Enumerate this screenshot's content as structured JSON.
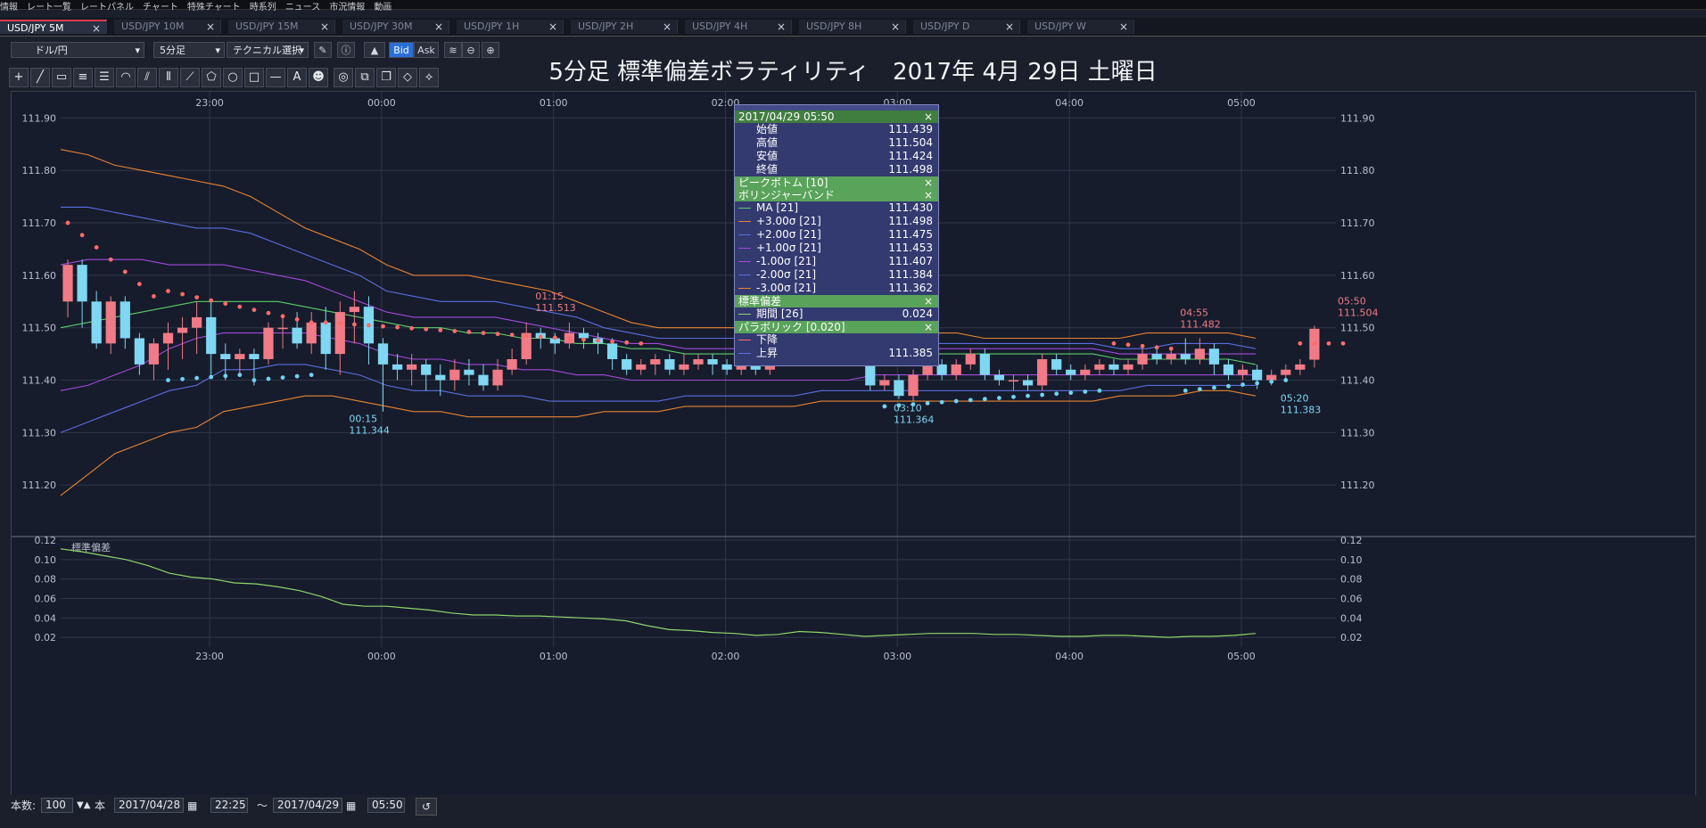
{
  "menubar": [
    "情報",
    "レート一覧",
    "レートパネル",
    "チャート",
    "特殊チャート",
    "時系列",
    "ニュース",
    "市況情報",
    "動画"
  ],
  "tabs": [
    {
      "label": "USD/JPY 5M",
      "active": true
    },
    {
      "label": "USD/JPY 10M"
    },
    {
      "label": "USD/JPY 15M"
    },
    {
      "label": "USD/JPY 30M"
    },
    {
      "label": "USD/JPY 1H"
    },
    {
      "label": "USD/JPY 2H"
    },
    {
      "label": "USD/JPY 4H"
    },
    {
      "label": "USD/JPY 8H"
    },
    {
      "label": "USD/JPY D"
    },
    {
      "label": "USD/JPY W"
    }
  ],
  "toolbar": {
    "pair": "ドル/円",
    "timeframe": "5分足",
    "technical": "テクニカル選択",
    "bid": "Bid",
    "ask": "Ask"
  },
  "title": "5分足 標準偏差ボラティリティ　2017年 4月 29日 土曜日",
  "chart_data": {
    "type": "candlestick",
    "y_axis": {
      "min": 111.1,
      "max": 111.95,
      "ticks": [
        "111.90",
        "111.80",
        "111.70",
        "111.60",
        "111.50",
        "111.40",
        "111.30",
        "111.20"
      ]
    },
    "time_labels": [
      "23:00",
      "00:00",
      "01:00",
      "02:00",
      "03:00",
      "04:00",
      "05:00"
    ],
    "annotations": [
      {
        "time": "00:15",
        "price": "111.344"
      },
      {
        "time": "01:15",
        "price": "111.513"
      },
      {
        "time": "03:10",
        "price": "111.364"
      },
      {
        "time": "04:55",
        "price": "111.482"
      },
      {
        "time": "05:20",
        "price": "111.383"
      },
      {
        "time": "05:50",
        "price": "111.504"
      }
    ],
    "candles": [
      [
        111.55,
        111.62,
        111.63,
        111.52
      ],
      [
        111.62,
        111.55,
        111.63,
        111.5
      ],
      [
        111.55,
        111.47,
        111.57,
        111.46
      ],
      [
        111.47,
        111.55,
        111.56,
        111.45
      ],
      [
        111.55,
        111.48,
        111.56,
        111.46
      ],
      [
        111.48,
        111.43,
        111.49,
        111.41
      ],
      [
        111.43,
        111.47,
        111.48,
        111.4
      ],
      [
        111.47,
        111.49,
        111.51,
        111.42
      ],
      [
        111.49,
        111.5,
        111.52,
        111.44
      ],
      [
        111.5,
        111.52,
        111.55,
        111.45
      ],
      [
        111.52,
        111.45,
        111.55,
        111.41
      ],
      [
        111.45,
        111.44,
        111.47,
        111.4
      ],
      [
        111.44,
        111.45,
        111.46,
        111.41
      ],
      [
        111.45,
        111.44,
        111.46,
        111.39
      ],
      [
        111.44,
        111.5,
        111.51,
        111.43
      ],
      [
        111.5,
        111.5,
        111.52,
        111.46
      ],
      [
        111.5,
        111.47,
        111.53,
        111.46
      ],
      [
        111.47,
        111.51,
        111.53,
        111.45
      ],
      [
        111.51,
        111.45,
        111.54,
        111.42
      ],
      [
        111.45,
        111.53,
        111.55,
        111.41
      ],
      [
        111.53,
        111.54,
        111.57,
        111.47
      ],
      [
        111.54,
        111.47,
        111.56,
        111.43
      ],
      [
        111.47,
        111.43,
        111.48,
        111.34
      ],
      [
        111.43,
        111.42,
        111.45,
        111.4
      ],
      [
        111.42,
        111.43,
        111.45,
        111.39
      ],
      [
        111.43,
        111.41,
        111.44,
        111.38
      ],
      [
        111.41,
        111.4,
        111.43,
        111.37
      ],
      [
        111.4,
        111.42,
        111.44,
        111.38
      ],
      [
        111.42,
        111.41,
        111.44,
        111.39
      ],
      [
        111.41,
        111.39,
        111.43,
        111.38
      ],
      [
        111.39,
        111.42,
        111.44,
        111.38
      ],
      [
        111.42,
        111.44,
        111.46,
        111.41
      ],
      [
        111.44,
        111.49,
        111.51,
        111.43
      ],
      [
        111.49,
        111.48,
        111.5,
        111.46
      ],
      [
        111.48,
        111.47,
        111.49,
        111.45
      ],
      [
        111.47,
        111.49,
        111.51,
        111.46
      ],
      [
        111.49,
        111.48,
        111.5,
        111.46
      ],
      [
        111.48,
        111.47,
        111.49,
        111.45
      ],
      [
        111.47,
        111.44,
        111.48,
        111.42
      ],
      [
        111.44,
        111.42,
        111.45,
        111.41
      ],
      [
        111.42,
        111.43,
        111.44,
        111.41
      ],
      [
        111.43,
        111.44,
        111.45,
        111.41
      ],
      [
        111.44,
        111.42,
        111.45,
        111.41
      ],
      [
        111.42,
        111.43,
        111.45,
        111.41
      ],
      [
        111.43,
        111.44,
        111.45,
        111.42
      ],
      [
        111.44,
        111.43,
        111.45,
        111.41
      ],
      [
        111.43,
        111.42,
        111.44,
        111.41
      ],
      [
        111.42,
        111.43,
        111.44,
        111.41
      ],
      [
        111.43,
        111.42,
        111.44,
        111.41
      ],
      [
        111.42,
        111.45,
        111.46,
        111.41
      ],
      [
        111.45,
        111.46,
        111.47,
        111.43
      ],
      [
        111.46,
        111.45,
        111.47,
        111.44
      ],
      [
        111.45,
        111.44,
        111.46,
        111.43
      ],
      [
        111.44,
        111.45,
        111.46,
        111.43
      ],
      [
        111.45,
        111.44,
        111.46,
        111.43
      ],
      [
        111.44,
        111.45,
        111.47,
        111.43
      ],
      [
        111.45,
        111.39,
        111.46,
        111.38
      ],
      [
        111.39,
        111.4,
        111.41,
        111.38
      ],
      [
        111.4,
        111.37,
        111.41,
        111.364
      ],
      [
        111.37,
        111.41,
        111.42,
        111.36
      ],
      [
        111.41,
        111.43,
        111.44,
        111.4
      ],
      [
        111.43,
        111.41,
        111.44,
        111.4
      ],
      [
        111.41,
        111.43,
        111.44,
        111.4
      ],
      [
        111.43,
        111.45,
        111.46,
        111.42
      ],
      [
        111.45,
        111.41,
        111.46,
        111.4
      ],
      [
        111.41,
        111.4,
        111.42,
        111.39
      ],
      [
        111.4,
        111.4,
        111.41,
        111.38
      ],
      [
        111.4,
        111.39,
        111.41,
        111.38
      ],
      [
        111.39,
        111.44,
        111.45,
        111.38
      ],
      [
        111.44,
        111.42,
        111.45,
        111.41
      ],
      [
        111.42,
        111.41,
        111.43,
        111.4
      ],
      [
        111.41,
        111.42,
        111.43,
        111.4
      ],
      [
        111.42,
        111.43,
        111.44,
        111.41
      ],
      [
        111.43,
        111.42,
        111.44,
        111.41
      ],
      [
        111.42,
        111.43,
        111.44,
        111.41
      ],
      [
        111.43,
        111.45,
        111.46,
        111.42
      ],
      [
        111.45,
        111.44,
        111.46,
        111.43
      ],
      [
        111.44,
        111.45,
        111.46,
        111.43
      ],
      [
        111.45,
        111.44,
        111.48,
        111.43
      ],
      [
        111.44,
        111.46,
        111.48,
        111.43
      ],
      [
        111.46,
        111.43,
        111.47,
        111.41
      ],
      [
        111.43,
        111.41,
        111.44,
        111.4
      ],
      [
        111.41,
        111.42,
        111.43,
        111.4
      ],
      [
        111.42,
        111.4,
        111.43,
        111.383
      ],
      [
        111.4,
        111.41,
        111.42,
        111.39
      ],
      [
        111.41,
        111.42,
        111.43,
        111.4
      ],
      [
        111.42,
        111.43,
        111.44,
        111.41
      ],
      [
        111.439,
        111.498,
        111.504,
        111.424
      ]
    ],
    "series": [
      {
        "name": "MA [21]",
        "color": "#5ecb6a",
        "values": [
          111.5,
          111.51,
          111.52,
          111.53,
          111.54,
          111.55,
          111.55,
          111.55,
          111.55,
          111.54,
          111.53,
          111.52,
          111.51,
          111.5,
          111.5,
          111.49,
          111.49,
          111.48,
          111.48,
          111.47,
          111.47,
          111.46,
          111.46,
          111.45,
          111.45,
          111.45,
          111.45,
          111.45,
          111.45,
          111.45,
          111.45,
          111.45,
          111.45,
          111.45,
          111.45,
          111.45,
          111.45,
          111.45,
          111.45,
          111.44,
          111.44,
          111.44,
          111.44,
          111.44,
          111.43
        ]
      },
      {
        "name": "+3.00σ [21]",
        "color": "#e78431",
        "values": [
          111.84,
          111.83,
          111.81,
          111.8,
          111.79,
          111.78,
          111.77,
          111.75,
          111.72,
          111.69,
          111.67,
          111.65,
          111.62,
          111.6,
          111.6,
          111.6,
          111.59,
          111.58,
          111.57,
          111.55,
          111.53,
          111.51,
          111.5,
          111.5,
          111.5,
          111.5,
          111.49,
          111.49,
          111.5,
          111.5,
          111.49,
          111.49,
          111.49,
          111.49,
          111.48,
          111.48,
          111.48,
          111.48,
          111.48,
          111.48,
          111.49,
          111.49,
          111.49,
          111.49,
          111.48
        ]
      },
      {
        "name": "+2.00σ [21]",
        "color": "#5a6ee0",
        "values": [
          111.73,
          111.73,
          111.72,
          111.71,
          111.7,
          111.69,
          111.69,
          111.68,
          111.66,
          111.64,
          111.62,
          111.6,
          111.57,
          111.56,
          111.55,
          111.55,
          111.55,
          111.54,
          111.53,
          111.52,
          111.5,
          111.49,
          111.48,
          111.48,
          111.48,
          111.48,
          111.48,
          111.48,
          111.48,
          111.48,
          111.47,
          111.47,
          111.47,
          111.47,
          111.47,
          111.47,
          111.47,
          111.47,
          111.47,
          111.46,
          111.46,
          111.47,
          111.47,
          111.47,
          111.46
        ]
      },
      {
        "name": "+1.00σ [21]",
        "color": "#a24adb",
        "values": [
          111.62,
          111.63,
          111.63,
          111.63,
          111.62,
          111.62,
          111.62,
          111.61,
          111.6,
          111.59,
          111.57,
          111.55,
          111.53,
          111.52,
          111.52,
          111.52,
          111.52,
          111.51,
          111.5,
          111.49,
          111.48,
          111.47,
          111.47,
          111.46,
          111.46,
          111.46,
          111.46,
          111.46,
          111.46,
          111.46,
          111.46,
          111.46,
          111.46,
          111.46,
          111.46,
          111.46,
          111.46,
          111.46,
          111.46,
          111.45,
          111.45,
          111.45,
          111.45,
          111.45,
          111.45
        ]
      },
      {
        "name": "-1.00σ [21]",
        "color": "#a24adb",
        "values": [
          111.38,
          111.39,
          111.41,
          111.43,
          111.46,
          111.48,
          111.49,
          111.49,
          111.49,
          111.49,
          111.48,
          111.47,
          111.45,
          111.44,
          111.44,
          111.43,
          111.43,
          111.42,
          111.42,
          111.41,
          111.41,
          111.4,
          111.4,
          111.4,
          111.4,
          111.4,
          111.4,
          111.4,
          111.4,
          111.4,
          111.41,
          111.41,
          111.41,
          111.41,
          111.41,
          111.41,
          111.41,
          111.41,
          111.41,
          111.41,
          111.41,
          111.41,
          111.41,
          111.41,
          111.41
        ]
      },
      {
        "name": "-2.00σ [21]",
        "color": "#5a6ee0",
        "values": [
          111.3,
          111.32,
          111.34,
          111.36,
          111.38,
          111.39,
          111.42,
          111.42,
          111.43,
          111.43,
          111.42,
          111.41,
          111.39,
          111.38,
          111.38,
          111.37,
          111.37,
          111.37,
          111.36,
          111.36,
          111.36,
          111.36,
          111.36,
          111.37,
          111.37,
          111.37,
          111.37,
          111.37,
          111.38,
          111.38,
          111.38,
          111.38,
          111.38,
          111.38,
          111.38,
          111.38,
          111.38,
          111.38,
          111.38,
          111.38,
          111.39,
          111.39,
          111.39,
          111.39,
          111.39
        ]
      },
      {
        "name": "-3.00σ [21]",
        "color": "#e78431",
        "values": [
          111.18,
          111.22,
          111.26,
          111.28,
          111.3,
          111.31,
          111.34,
          111.35,
          111.36,
          111.37,
          111.37,
          111.36,
          111.35,
          111.34,
          111.34,
          111.33,
          111.33,
          111.33,
          111.33,
          111.33,
          111.34,
          111.34,
          111.34,
          111.35,
          111.35,
          111.35,
          111.35,
          111.35,
          111.36,
          111.36,
          111.36,
          111.36,
          111.36,
          111.36,
          111.36,
          111.36,
          111.36,
          111.36,
          111.36,
          111.37,
          111.37,
          111.37,
          111.38,
          111.38,
          111.37
        ]
      }
    ],
    "sar_down": {
      "color": "#ff6b6b",
      "from": 0,
      "to": 17,
      "start": 111.7,
      "end": 111.51
    },
    "sar_down2": {
      "color": "#ff6b6b",
      "from": 18,
      "to": 45,
      "start": 111.51,
      "end": 111.47
    },
    "sar_up": {
      "color": "#6fd3f0"
    },
    "subchart": {
      "label": "標準偏差",
      "ticks": [
        "0.12",
        "0.10",
        "0.08",
        "0.06",
        "0.04",
        "0.02"
      ],
      "min": 0.01,
      "max": 0.12,
      "values": [
        0.111,
        0.108,
        0.104,
        0.1,
        0.094,
        0.086,
        0.082,
        0.08,
        0.076,
        0.075,
        0.072,
        0.068,
        0.062,
        0.054,
        0.052,
        0.052,
        0.05,
        0.048,
        0.045,
        0.043,
        0.043,
        0.042,
        0.042,
        0.041,
        0.04,
        0.039,
        0.037,
        0.032,
        0.028,
        0.027,
        0.025,
        0.024,
        0.022,
        0.023,
        0.026,
        0.025,
        0.023,
        0.021,
        0.022,
        0.023,
        0.024,
        0.024,
        0.024,
        0.023,
        0.023,
        0.022,
        0.021,
        0.021,
        0.022,
        0.022,
        0.021,
        0.02,
        0.021,
        0.021,
        0.022,
        0.024
      ]
    }
  },
  "popup": {
    "datetime": "2017/04/29 05:50",
    "ohlc": [
      {
        "label": "始値",
        "value": "111.439"
      },
      {
        "label": "高値",
        "value": "111.504"
      },
      {
        "label": "安値",
        "value": "111.424"
      },
      {
        "label": "終値",
        "value": "111.498"
      }
    ],
    "peak": "ピークボトム [10]",
    "bollinger": "ボリンジャーバンド",
    "bb": [
      {
        "label": "MA [21]",
        "value": "111.430",
        "color": "#5ecb6a"
      },
      {
        "label": "+3.00σ [21]",
        "value": "111.498",
        "color": "#e78431"
      },
      {
        "label": "+2.00σ [21]",
        "value": "111.475",
        "color": "#5a6ee0"
      },
      {
        "label": "+1.00σ [21]",
        "value": "111.453",
        "color": "#a24adb"
      },
      {
        "label": "-1.00σ [21]",
        "value": "111.407",
        "color": "#a24adb"
      },
      {
        "label": "-2.00σ [21]",
        "value": "111.384",
        "color": "#5a6ee0"
      },
      {
        "label": "-3.00σ [21]",
        "value": "111.362",
        "color": "#e78431"
      }
    ],
    "std": "標準偏差",
    "std_row": {
      "label": "期間 [26]",
      "value": "0.024"
    },
    "sar": "パラボリック [0.020]",
    "sar_rows": [
      {
        "label": "下降",
        "value": ""
      },
      {
        "label": "上昇",
        "value": "111.385"
      }
    ]
  },
  "status": {
    "count_label": "本数:",
    "count": "100",
    "unit": "本",
    "date_from": "2017/04/28",
    "time_from": "22:25",
    "tilde": "～",
    "date_to": "2017/04/29",
    "time_to": "05:50"
  }
}
